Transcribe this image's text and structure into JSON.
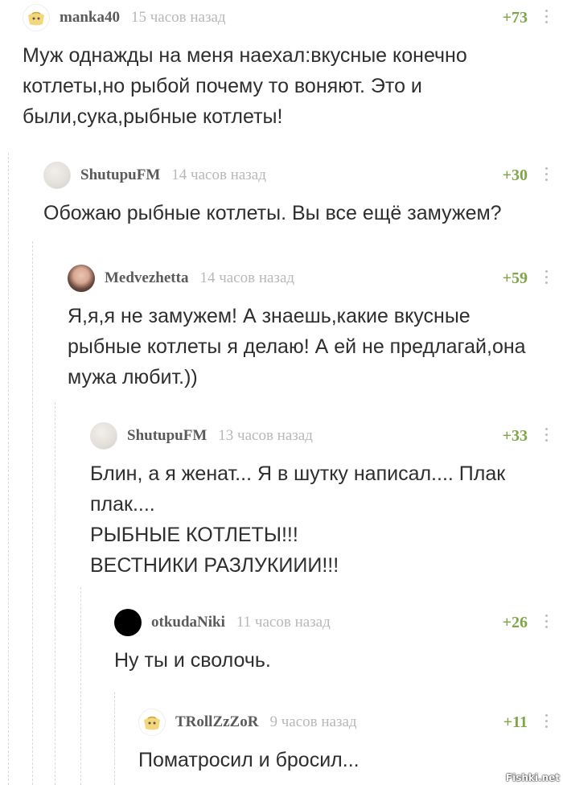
{
  "comments": [
    {
      "username": "manka40",
      "time": "15 часов назад",
      "rating": "+73",
      "avatar": "pikabu-icon",
      "text": "Муж однажды на меня наехал:вкусные конечно котлеты,но рыбой почему то воняют. Это и были,сука,рыбные котлеты!"
    },
    {
      "username": "ShutupuFM",
      "time": "14 часов назад",
      "rating": "+30",
      "avatar": "grey-circle-icon",
      "text": "Обожаю рыбные котлеты. Вы все ещё замужем?"
    },
    {
      "username": "Medvezhetta",
      "time": "14 часов назад",
      "rating": "+59",
      "avatar": "user-photo",
      "text": "Я,я,я не замужем! А знаешь,какие вкусные рыбные котлеты я делаю! А ей не предлагай,она мужа любит.))"
    },
    {
      "username": "ShutupuFM",
      "time": "13 часов назад",
      "rating": "+33",
      "avatar": "grey-circle-icon",
      "text": "Блин, а я женат... Я в шутку написал.... Плак плак....\nРЫБНЫЕ КОТЛЕТЫ!!!\nВЕСТНИКИ РАЗЛУКИИИ!!!"
    },
    {
      "username": "otkudaNiki",
      "time": "11 часов назад",
      "rating": "+26",
      "avatar": "black-circle-icon",
      "text": "Ну ты и сволочь."
    },
    {
      "username": "TRollZzZoR",
      "time": "9 часов назад",
      "rating": "+11",
      "avatar": "pikabu-icon",
      "text": "Поматросил и бросил..."
    }
  ],
  "watermark": "Fishki.net",
  "colors": {
    "rating": "#7fa646",
    "username": "#5a5a5a",
    "time": "#b8b8b8",
    "text": "#2e2e2e"
  }
}
